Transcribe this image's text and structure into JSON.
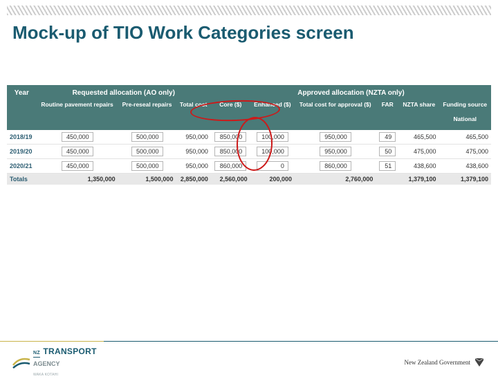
{
  "title": "Mock-up of TIO Work Categories screen",
  "header": {
    "group_year": "Year",
    "group_requested": "Requested allocation (AO only)",
    "group_approved": "Approved allocation (NZTA only)",
    "sub": {
      "routine": "Routine pavement repairs",
      "preseal": "Pre-reseal repairs",
      "total": "Total cost",
      "core": "Core ($)",
      "enhanced": "Enhanced ($)",
      "total_approval": "Total cost for approval ($)",
      "far": "FAR",
      "nzta_share": "NZTA share",
      "funding_source": "Funding source",
      "national": "National"
    }
  },
  "rows": [
    {
      "year": "2018/19",
      "routine": "450,000",
      "preseal": "500,000",
      "total": "950,000",
      "core": "850,000",
      "enhanced": "100,000",
      "total_approval": "950,000",
      "far": "49",
      "nzta_share": "465,500",
      "funding": "465,500"
    },
    {
      "year": "2019/20",
      "routine": "450,000",
      "preseal": "500,000",
      "total": "950,000",
      "core": "850,000",
      "enhanced": "100,000",
      "total_approval": "950,000",
      "far": "50",
      "nzta_share": "475,000",
      "funding": "475,000"
    },
    {
      "year": "2020/21",
      "routine": "450,000",
      "preseal": "500,000",
      "total": "950,000",
      "core": "860,000",
      "enhanced": "0",
      "total_approval": "860,000",
      "far": "51",
      "nzta_share": "438,600",
      "funding": "438,600"
    }
  ],
  "totals": {
    "label": "Totals",
    "routine": "1,350,000",
    "preseal": "1,500,000",
    "total": "2,850,000",
    "core": "2,560,000",
    "enhanced": "200,000",
    "total_approval": "2,760,000",
    "far": "",
    "nzta_share": "1,379,100",
    "funding": "1,379,100"
  },
  "footer": {
    "left": {
      "nz": "NZ",
      "brand": "TRANSPORT",
      "agency": "AGENCY",
      "maori": "WAKA KOTAHI"
    },
    "right": {
      "label": "New Zealand Government"
    }
  }
}
